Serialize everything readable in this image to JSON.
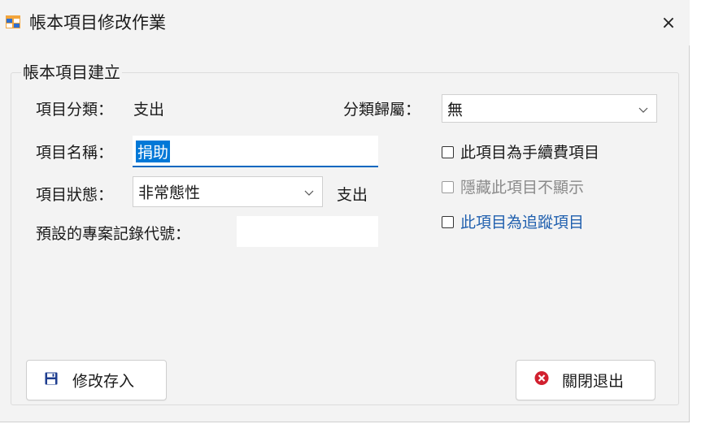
{
  "window": {
    "title": "帳本項目修改作業",
    "close_glyph": "×"
  },
  "group": {
    "label": "帳本項目建立"
  },
  "fields": {
    "category_label": "項目分類：",
    "category_value": "支出",
    "parent_label": "分類歸屬：",
    "parent_value": "無",
    "name_label": "項目名稱：",
    "name_value": "捐助",
    "status_label": "項目狀態：",
    "status_value": "非常態性",
    "status_type": "支出",
    "project_code_label": "預設的專案記錄代號：",
    "project_code_value": ""
  },
  "checkboxes": {
    "fee": {
      "label": "此項目為手續費項目",
      "checked": false
    },
    "hide": {
      "label": "隱藏此項目不顯示",
      "checked": false,
      "disabled": true
    },
    "track": {
      "label": "此項目為追蹤項目",
      "checked": false
    }
  },
  "buttons": {
    "save": "修改存入",
    "close": "關閉退出"
  },
  "colors": {
    "accent": "#0078d7",
    "track_text": "#1f5fae",
    "disabled_text": "#8a8a8a",
    "close_icon": "#d1202f",
    "save_icon": "#1e3d8f"
  },
  "icons": {
    "chevron": "⌄"
  }
}
